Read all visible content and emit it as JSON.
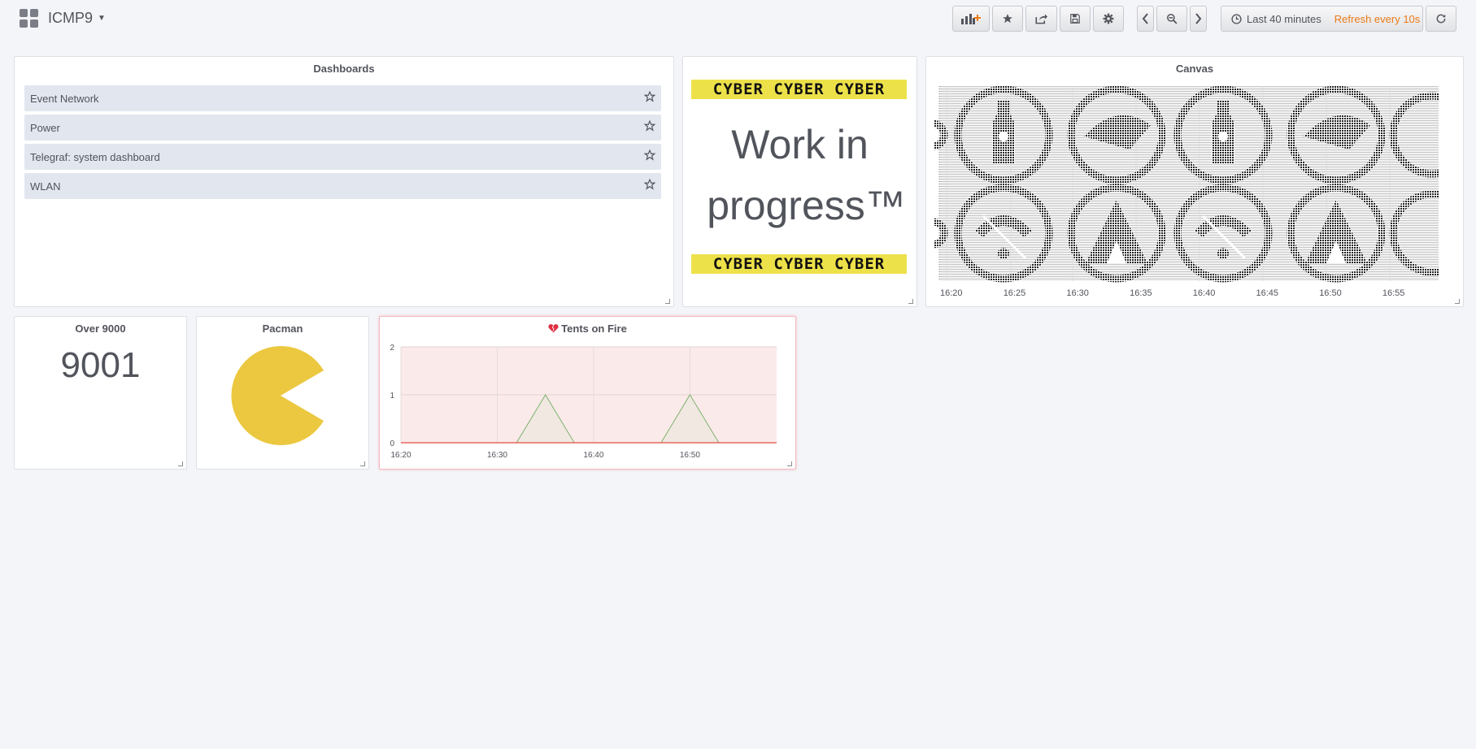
{
  "header": {
    "title": "ICMP9",
    "time_range": "Last 40 minutes",
    "refresh": "Refresh every 10s"
  },
  "panels": {
    "dashboards": {
      "title": "Dashboards",
      "items": [
        {
          "label": "Event Network"
        },
        {
          "label": "Power"
        },
        {
          "label": "Telegraf: system dashboard"
        },
        {
          "label": "WLAN"
        }
      ]
    },
    "wip": {
      "banner": "CYBER CYBER CYBER",
      "line1": "Work in",
      "line2": "progress™"
    },
    "canvas": {
      "title": "Canvas",
      "ticks": [
        "16:20",
        "16:25",
        "16:30",
        "16:35",
        "16:40",
        "16:45",
        "16:50",
        "16:55"
      ]
    },
    "stat": {
      "title": "Over 9000",
      "value": "9001"
    },
    "pacman": {
      "title": "Pacman"
    },
    "tents": {
      "title": "Tents on Fire"
    }
  },
  "colors": {
    "accent_orange": "#eb7b18",
    "pacman_yellow": "#ebc83f",
    "alert_red": "#e02f44",
    "banner_yellow": "#ede14a"
  },
  "icons": [
    "grid-icon",
    "add-panel-icon",
    "star-icon",
    "share-icon",
    "save-icon",
    "gear-icon",
    "chevron-left-icon",
    "zoom-out-icon",
    "chevron-right-icon",
    "clock-icon",
    "refresh-icon",
    "broken-heart-icon"
  ],
  "chart_data": {
    "type": "area",
    "title": "Tents on Fire",
    "x": [
      "16:20",
      "16:23",
      "16:26",
      "16:29",
      "16:32",
      "16:35",
      "16:38",
      "16:41",
      "16:44",
      "16:47",
      "16:50",
      "16:53",
      "16:56",
      "16:59"
    ],
    "series": [
      {
        "values": [
          0,
          0,
          0,
          0,
          0,
          1,
          0,
          0,
          0,
          0,
          1,
          0,
          0,
          0
        ]
      }
    ],
    "xticks": [
      "16:20",
      "16:30",
      "16:40",
      "16:50"
    ],
    "yticks": [
      "0",
      "1",
      "2"
    ],
    "ylim": [
      0,
      2
    ],
    "grid": true
  }
}
